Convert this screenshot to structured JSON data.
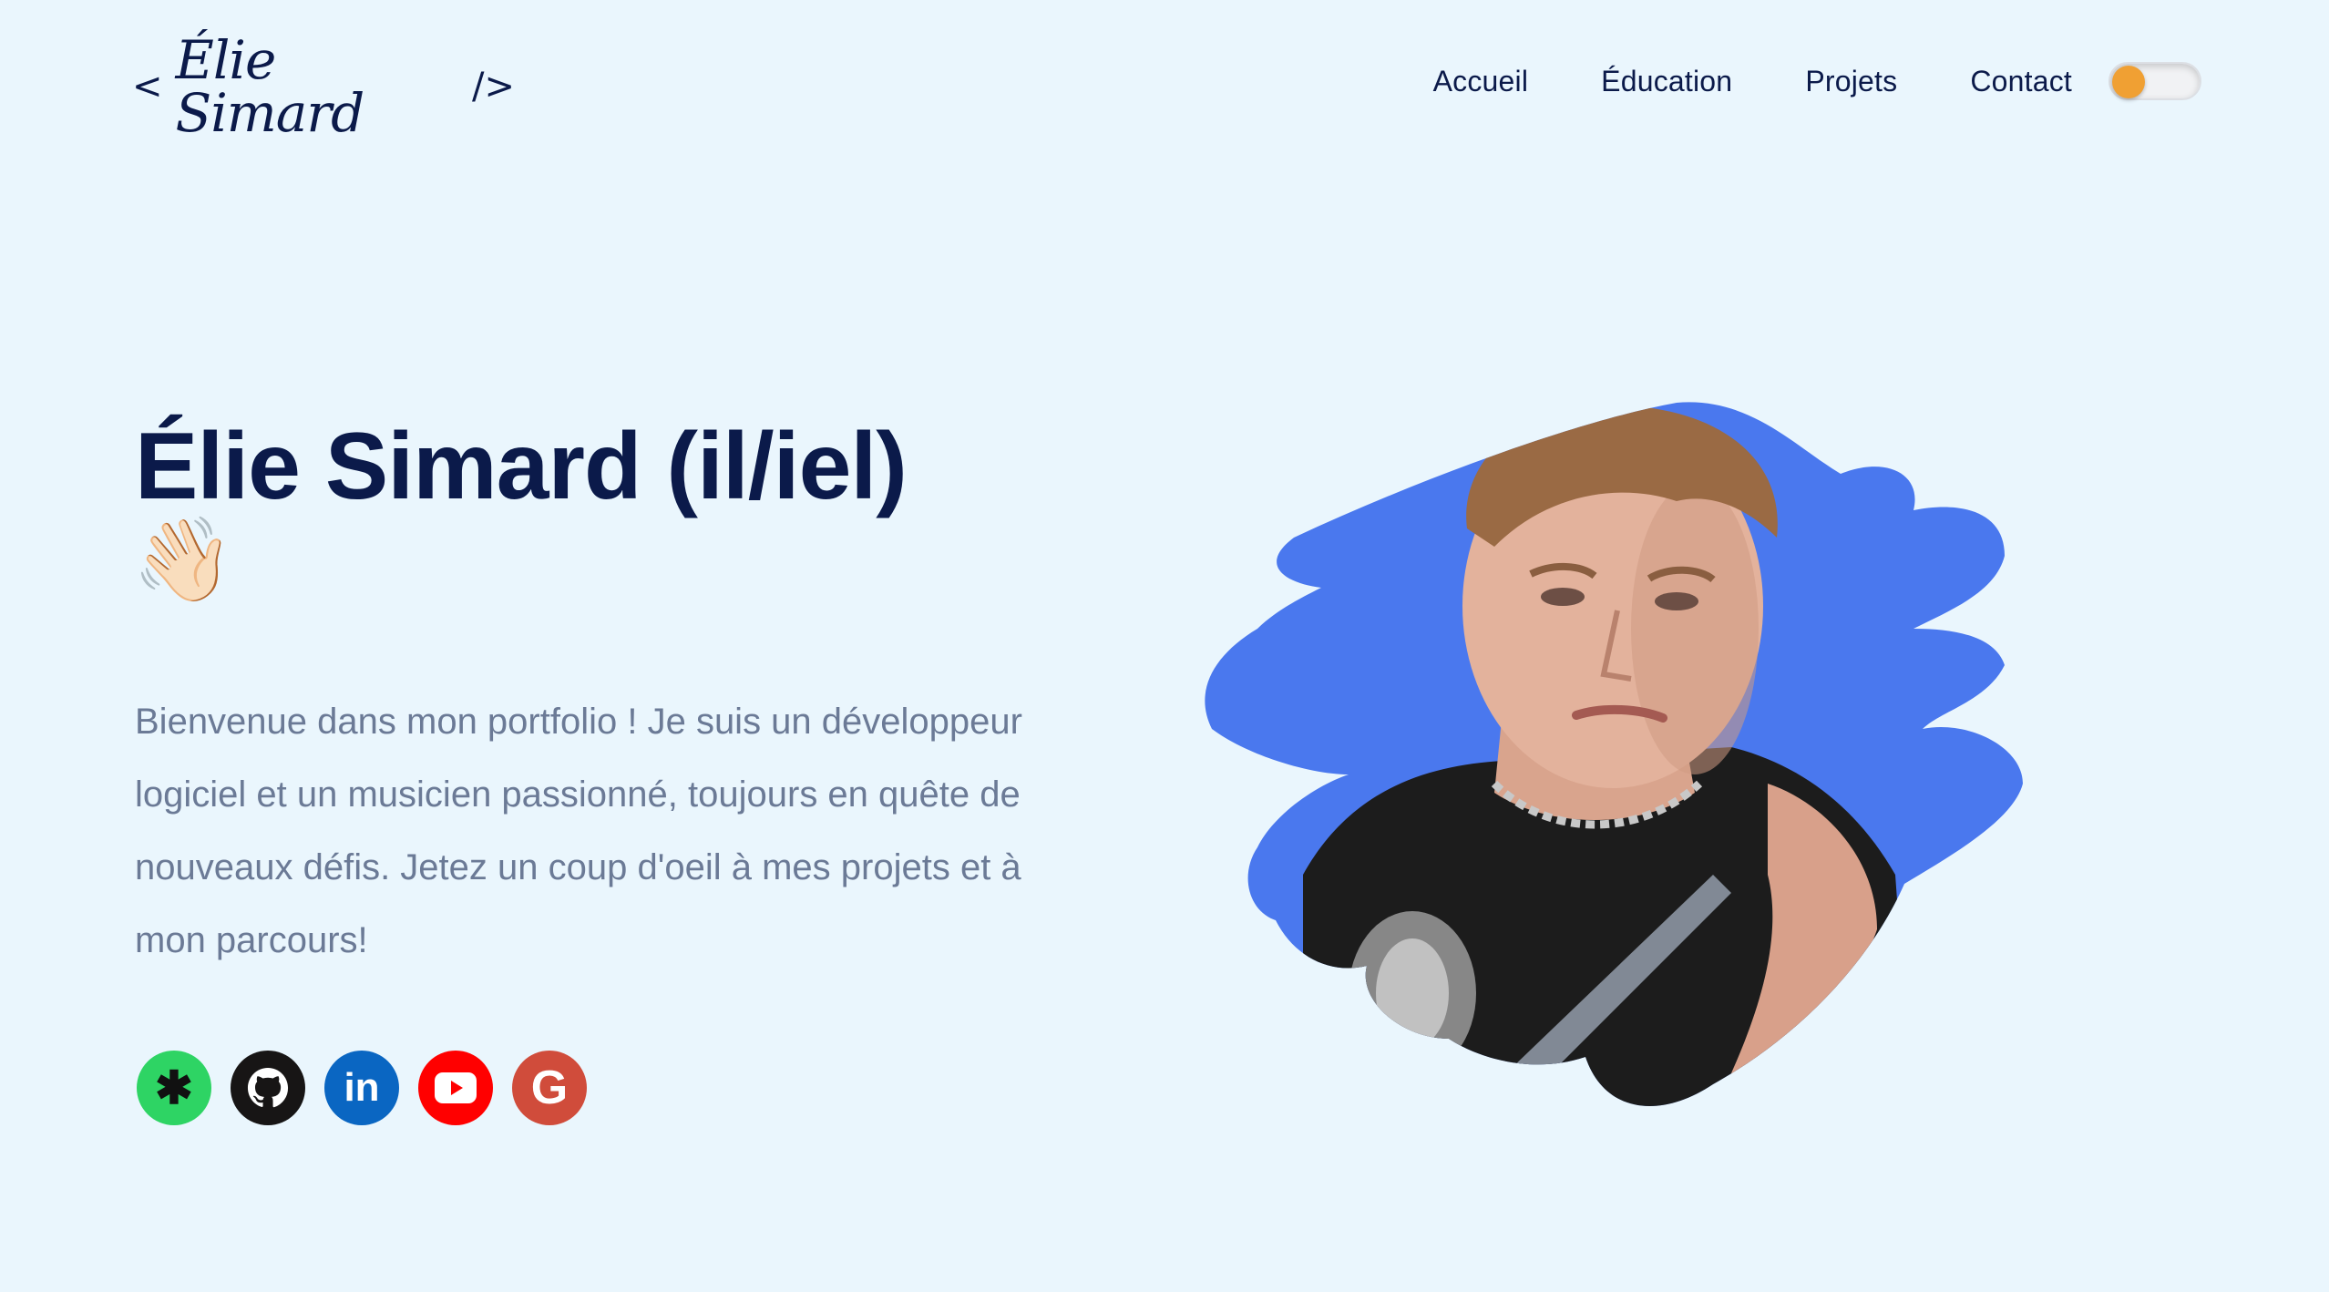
{
  "header": {
    "logo": {
      "open_bracket": "<",
      "signature": "Élie Simard",
      "close_bracket": "/>"
    },
    "nav": [
      {
        "label": "Accueil"
      },
      {
        "label": "Éducation"
      },
      {
        "label": "Projets"
      },
      {
        "label": "Contact"
      }
    ],
    "theme_toggle": {
      "state": "off",
      "knob_color": "#f0a033"
    }
  },
  "hero": {
    "title": "Élie Simard (il/iel)",
    "emoji": "👋🏻",
    "intro": "Bienvenue dans mon portfolio ! Je suis un développeur logiciel et un musicien passionné, toujours en quête de nouveaux défis. Jetez un coup d'oeil à mes projets et à mon parcours!"
  },
  "socials": [
    {
      "name": "linktree-icon",
      "color": "#2ed464",
      "glyph": "✱"
    },
    {
      "name": "github-icon",
      "color": "#171515",
      "glyph": ""
    },
    {
      "name": "linkedin-icon",
      "color": "#0a66c2",
      "glyph": "in"
    },
    {
      "name": "youtube-icon",
      "color": "#ff0000",
      "glyph": ""
    },
    {
      "name": "google-icon",
      "color": "#d04c3b",
      "glyph": "G"
    }
  ],
  "portrait": {
    "blob_color": "#4a78ee",
    "shirt_color": "#1c1c1c"
  },
  "colors": {
    "background": "#eaf6fd",
    "heading": "#0b1a4a",
    "body_text": "#6b7a96"
  }
}
